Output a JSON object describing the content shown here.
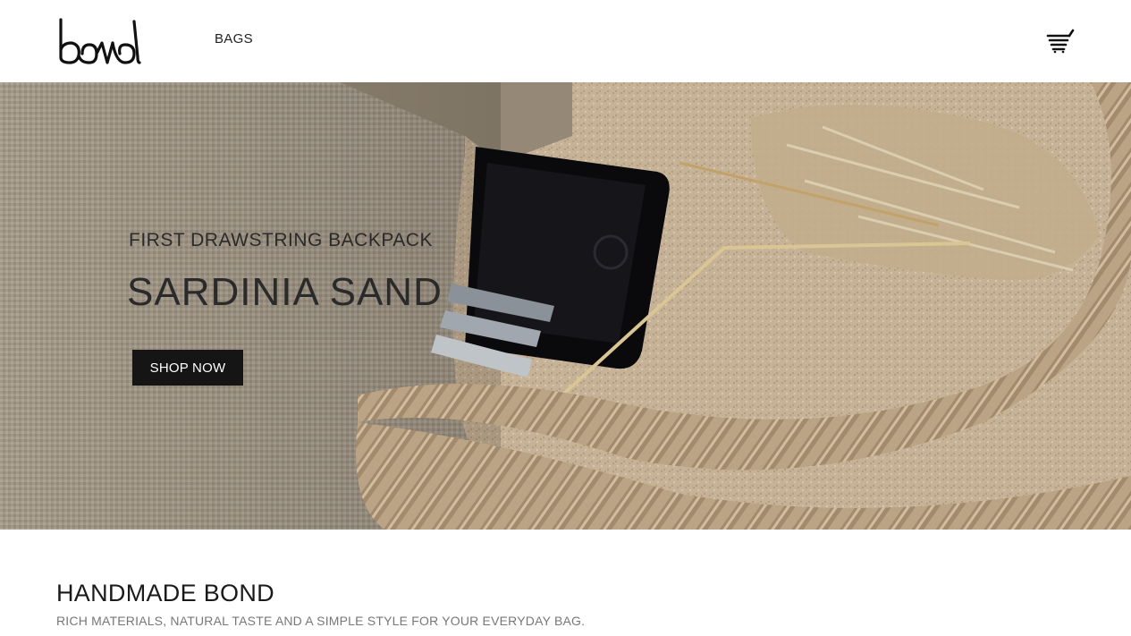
{
  "header": {
    "logo_text": "bond",
    "nav": [
      {
        "label": "BAGS"
      }
    ],
    "cart_icon": "shopping-cart-icon"
  },
  "hero": {
    "subtitle": "FIRST DRAWSTRING BACKPACK",
    "title": "SARDINIA SAND",
    "cta_label": "SHOP NOW"
  },
  "section": {
    "title": "HANDMADE BOND",
    "subtitle": "RICH MATERIALS, NATURAL TASTE AND A SIMPLE STYLE FOR YOUR EVERYDAY BAG."
  },
  "colors": {
    "button_bg": "#151515",
    "text_dark": "#1a1a1a",
    "text_muted": "#777777",
    "sand": "#c9b49a"
  }
}
